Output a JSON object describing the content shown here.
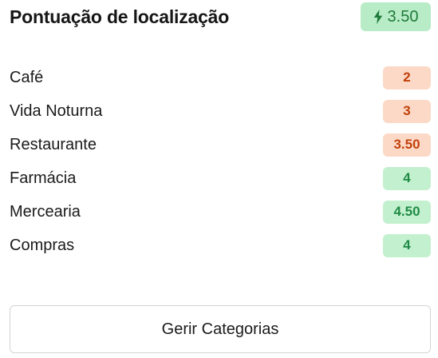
{
  "header": {
    "title": "Pontuação de localização",
    "score": "3.50",
    "score_icon": "lightning-bolt-icon",
    "score_bg": "#b7ecc6",
    "score_fg": "#1f7a3a"
  },
  "colors": {
    "low_bg": "#fcd9c6",
    "low_fg": "#c2410c",
    "high_bg": "#c3f0cf",
    "high_fg": "#1f8a45"
  },
  "categories": [
    {
      "label": "Café",
      "score": "2",
      "level": "low"
    },
    {
      "label": "Vida Noturna",
      "score": "3",
      "level": "low"
    },
    {
      "label": "Restaurante",
      "score": "3.50",
      "level": "low"
    },
    {
      "label": "Farmácia",
      "score": "4",
      "level": "high"
    },
    {
      "label": "Mercearia",
      "score": "4.50",
      "level": "high"
    },
    {
      "label": "Compras",
      "score": "4",
      "level": "high"
    }
  ],
  "actions": {
    "manage_label": "Gerir Categorias"
  }
}
